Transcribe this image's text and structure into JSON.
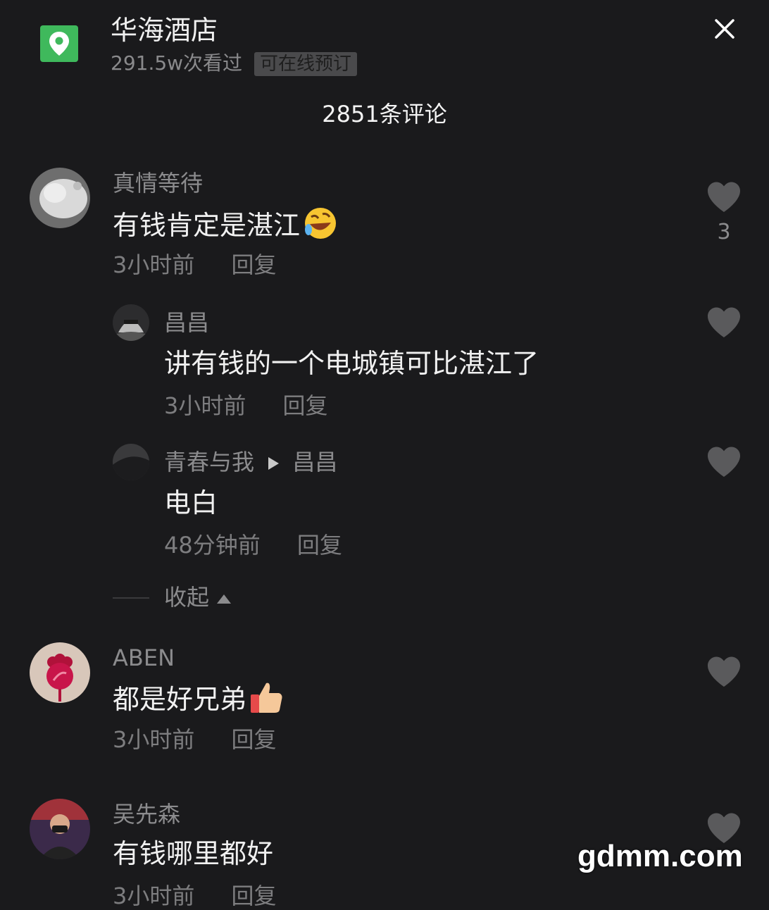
{
  "header": {
    "place_name": "华海酒店",
    "views": "291.5w次看过",
    "badge": "可在线预订",
    "comment_count": "2851条评论"
  },
  "comments": [
    {
      "user": "真情等待",
      "text": "有钱肯定是湛江",
      "emoji": "rolling-laughing-emoji",
      "time": "3小时前",
      "reply": "回复",
      "likes": "3"
    },
    {
      "user": "昌昌",
      "text": "讲有钱的一个电城镇可比湛江了",
      "time": "3小时前",
      "reply": "回复"
    },
    {
      "user": "青春与我",
      "reply_to": "昌昌",
      "text": "电白",
      "time": "48分钟前",
      "reply": "回复"
    },
    {
      "user": "ABEN",
      "text": "都是好兄弟",
      "emoji": "thumbs-up-emoji",
      "time": "3小时前",
      "reply": "回复"
    },
    {
      "user": "吴先森",
      "text": "有钱哪里都好",
      "time": "3小时前",
      "reply": "回复"
    }
  ],
  "collapse_label": "收起",
  "watermark": "gdmm.com",
  "colors": {
    "background": "#1a1a1c",
    "location_icon_bg": "#3fb95c",
    "heart": "#5a5a5c"
  }
}
